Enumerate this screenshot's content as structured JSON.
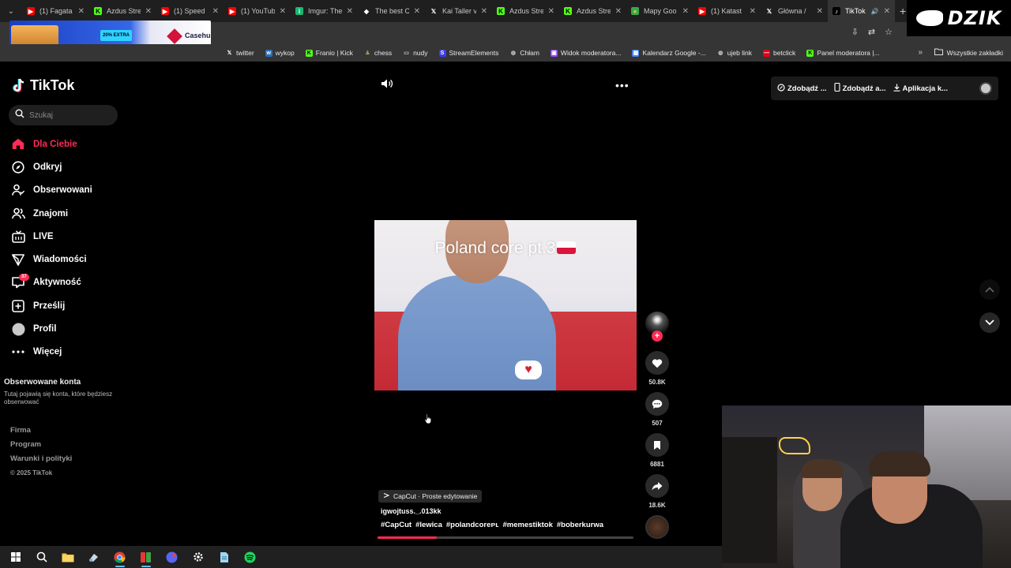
{
  "browser": {
    "tabs": [
      {
        "title": "(1) Fagata",
        "fav": "yt"
      },
      {
        "title": "Azdus Stre",
        "fav": "kick"
      },
      {
        "title": "(1) Speed",
        "fav": "yt"
      },
      {
        "title": "(1) YouTub",
        "fav": "yt"
      },
      {
        "title": "Imgur: The",
        "fav": "imgur"
      },
      {
        "title": "The best C",
        "fav": "diamond"
      },
      {
        "title": "Kai Taller v",
        "fav": "x"
      },
      {
        "title": "Azdus Stre",
        "fav": "kick"
      },
      {
        "title": "Azdus Stre",
        "fav": "kick"
      },
      {
        "title": "Mapy Goo",
        "fav": "maps"
      },
      {
        "title": "(1) Katast",
        "fav": "yt"
      },
      {
        "title": "Główna / ",
        "fav": "x"
      },
      {
        "title": "TikTok",
        "fav": "tiktok",
        "active": true
      }
    ],
    "bookmarks": [
      {
        "label": "twitter",
        "icon": "x"
      },
      {
        "label": "wykop",
        "icon": "wykop"
      },
      {
        "label": "Franio | Kick",
        "icon": "kick"
      },
      {
        "label": "chess",
        "icon": "pawn"
      },
      {
        "label": "nudy",
        "icon": "folder"
      },
      {
        "label": "StreamElements",
        "icon": "se"
      },
      {
        "label": "Chłam",
        "icon": "globe"
      },
      {
        "label": "Widok moderatora...",
        "icon": "twitch"
      },
      {
        "label": "Kalendarz Google -...",
        "icon": "calendar"
      },
      {
        "label": "ujeb link",
        "icon": "globe"
      },
      {
        "label": "betclick",
        "icon": "betclic"
      },
      {
        "label": "Panel moderatora |...",
        "icon": "kick"
      }
    ],
    "bookmarks_more": "»",
    "all_bookmarks": "Wszystkie zakładki",
    "promo_brand": "Casehug",
    "promo_badge": "20% EXTRA"
  },
  "overlay": {
    "brand": "DZIK"
  },
  "tiktok": {
    "logo": "TikTok",
    "search_placeholder": "Szukaj",
    "nav": [
      {
        "label": "Dla Ciebie",
        "icon": "home-icon",
        "active": true
      },
      {
        "label": "Odkryj",
        "icon": "compass-icon"
      },
      {
        "label": "Obserwowani",
        "icon": "following-icon"
      },
      {
        "label": "Znajomi",
        "icon": "friends-icon"
      },
      {
        "label": "LIVE",
        "icon": "live-icon"
      },
      {
        "label": "Wiadomości",
        "icon": "messages-icon"
      },
      {
        "label": "Aktywność",
        "icon": "activity-icon",
        "badge": "37"
      },
      {
        "label": "Prześlij",
        "icon": "upload-icon"
      },
      {
        "label": "Profil",
        "icon": "profile-icon"
      },
      {
        "label": "Więcej",
        "icon": "more-icon"
      }
    ],
    "followed_heading": "Obserwowane konta",
    "followed_desc": "Tutaj pojawią się konta, które będziesz obserwować",
    "footer": [
      "Firma",
      "Program",
      "Warunki i polityki"
    ],
    "copyright": "© 2025 TikTok",
    "top_actions": [
      "Zdobądź ...",
      "Zdobądź a...",
      "Aplikacja k..."
    ],
    "video": {
      "caption": "Poland core pt.3",
      "likes": "50.8K",
      "comments": "507",
      "saves": "6881",
      "shares": "18.6K",
      "capcut_label": "CapCut · Proste edytowanie",
      "author": "igwojtuss._.013kk",
      "hashtags": [
        "#CapCut",
        "#lewica",
        "#polandcoreᴘʟ",
        "#memestiktok",
        "#boberkurwa"
      ],
      "progress": 0.23
    }
  },
  "colors": {
    "accent": "#fe2c55"
  }
}
